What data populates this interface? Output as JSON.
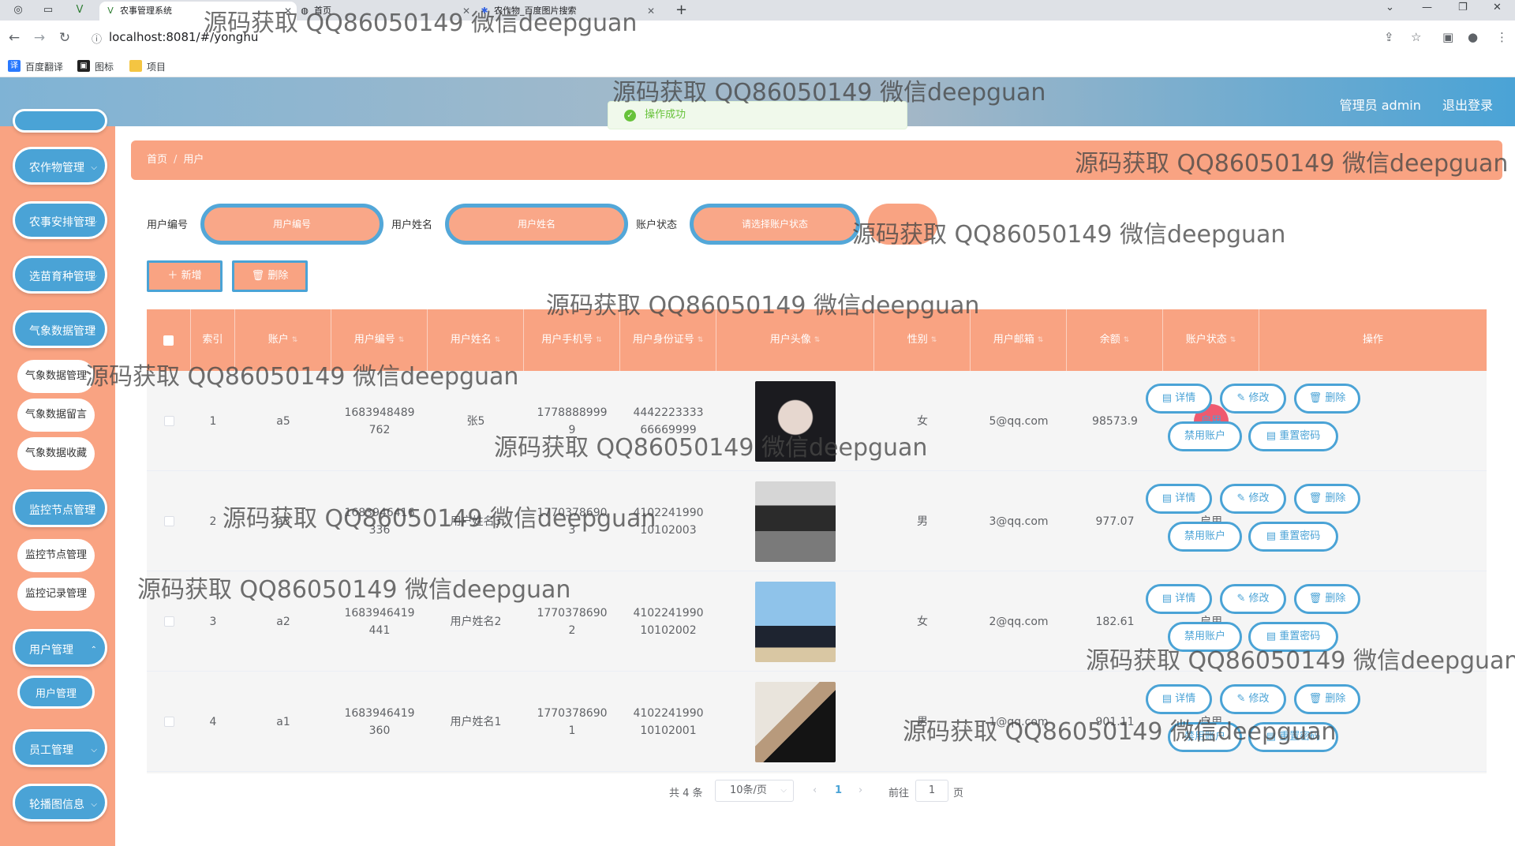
{
  "browser": {
    "tabs": [
      {
        "label": "农事管理系统",
        "active": true
      },
      {
        "label": "首页",
        "active": false
      },
      {
        "label": "农作物_百度图片搜索",
        "active": false
      }
    ],
    "url": "localhost:8081/#/yonghu",
    "bookmarks": [
      "百度翻译",
      "图标",
      "项目"
    ]
  },
  "header": {
    "admin_label": "管理员 admin",
    "logout_label": "退出登录"
  },
  "toast": {
    "message": "操作成功"
  },
  "sidebar": {
    "items": [
      {
        "label": "农作物管理",
        "type": "group"
      },
      {
        "label": "农事安排管理",
        "type": "group"
      },
      {
        "label": "选苗育种管理",
        "type": "group"
      },
      {
        "label": "气象数据管理",
        "type": "group"
      },
      {
        "label": "气象数据管理",
        "type": "sub"
      },
      {
        "label": "气象数据留言",
        "type": "sub"
      },
      {
        "label": "气象数据收藏",
        "type": "sub"
      },
      {
        "label": "监控节点管理",
        "type": "group"
      },
      {
        "label": "监控节点管理",
        "type": "sub"
      },
      {
        "label": "监控记录管理",
        "type": "sub"
      },
      {
        "label": "用户管理",
        "type": "group"
      },
      {
        "label": "用户管理",
        "type": "sub-active"
      },
      {
        "label": "员工管理",
        "type": "group"
      },
      {
        "label": "轮播图信息",
        "type": "group"
      }
    ]
  },
  "breadcrumb": {
    "home": "首页",
    "current": "用户"
  },
  "filters": {
    "user_no_label": "用户编号",
    "user_no_placeholder": "用户编号",
    "user_name_label": "用户姓名",
    "user_name_placeholder": "用户姓名",
    "status_label": "账户状态",
    "status_placeholder": "请选择账户状态"
  },
  "actions": {
    "add": "新增",
    "delete": "删除"
  },
  "table": {
    "headers": [
      "索引",
      "账户",
      "用户编号",
      "用户姓名",
      "用户手机号",
      "用户身份证号",
      "用户头像",
      "性别",
      "用户邮箱",
      "余额",
      "账户状态",
      "操作"
    ],
    "op_labels": {
      "detail": "详情",
      "edit": "修改",
      "delete": "删除",
      "disable": "禁用账户",
      "reset": "重置密码"
    },
    "rows": [
      {
        "index": "1",
        "account": "a5",
        "user_no": "1683948489762",
        "name": "张5",
        "phone": "17788889999",
        "id_card": "444222333366669999",
        "gender": "女",
        "email": "5@qq.com",
        "balance": "98573.9",
        "status": "启用"
      },
      {
        "index": "2",
        "account": "a3",
        "user_no": "1683946416336",
        "name": "用户姓名3",
        "phone": "17703786903",
        "id_card": "410224199010102003",
        "gender": "男",
        "email": "3@qq.com",
        "balance": "977.07",
        "status": "启用"
      },
      {
        "index": "3",
        "account": "a2",
        "user_no": "1683946419441",
        "name": "用户姓名2",
        "phone": "17703786902",
        "id_card": "410224199010102002",
        "gender": "女",
        "email": "2@qq.com",
        "balance": "182.61",
        "status": "启用"
      },
      {
        "index": "4",
        "account": "a1",
        "user_no": "1683946419360",
        "name": "用户姓名1",
        "phone": "17703786901",
        "id_card": "410224199010102001",
        "gender": "男",
        "email": "1@qq.com",
        "balance": "901.11",
        "status": "启用"
      }
    ]
  },
  "pagination": {
    "total": "共 4 条",
    "page_size": "10条/页",
    "current": "1",
    "goto_label": "前往",
    "goto_value": "1",
    "page_suffix": "页"
  },
  "watermark": "源码获取 QQ86050149 微信deepguan",
  "colors": {
    "accent_blue": "#4aa3d6",
    "salmon": "#f9a382",
    "status_red": "#ef5a6f"
  }
}
